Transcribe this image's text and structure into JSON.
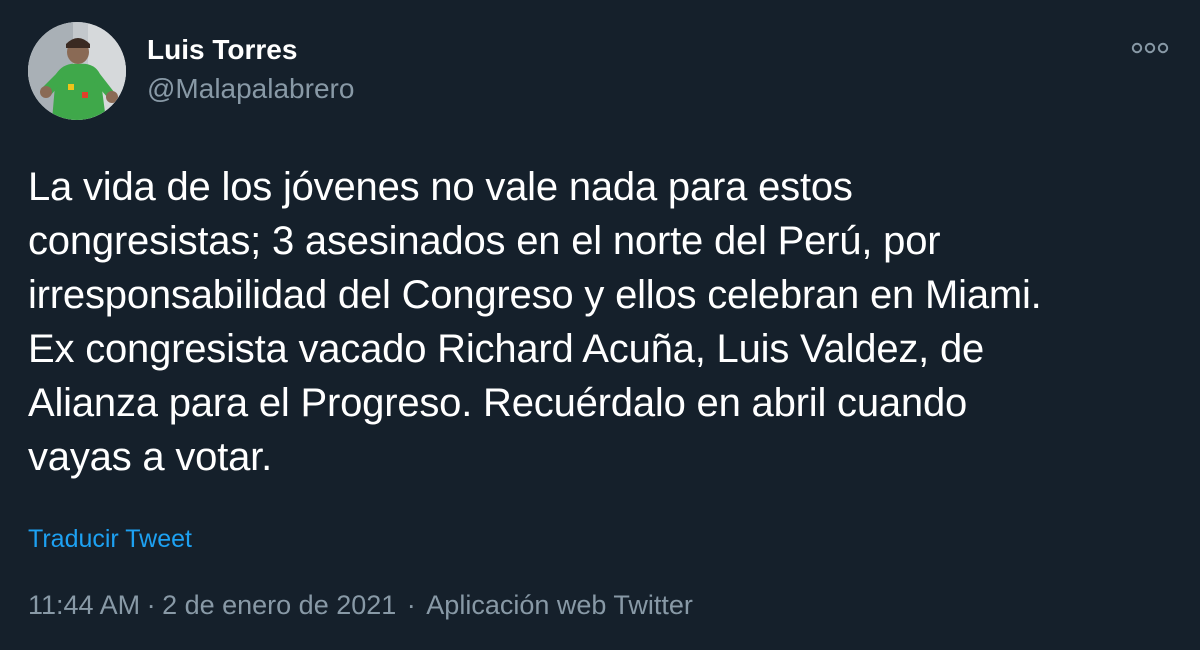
{
  "author": {
    "display_name": "Luis Torres",
    "handle": "@Malapalabrero",
    "avatar_icon": "profile-photo"
  },
  "tweet": {
    "text": "La vida de los jóvenes no vale nada para estos\ncongresistas; 3 asesinados en el norte del Perú, por\nirresponsabilidad del Congreso y ellos celebran en Miami.\nEx congresista vacado Richard Acuña, Luis Valdez, de\nAlianza para el Progreso. Recuérdalo en abril cuando\nvayas a votar.",
    "translate_label": "Traducir Tweet"
  },
  "meta": {
    "time": "11:44 AM",
    "date": "2 de enero de 2021",
    "separator": "·",
    "source": "Aplicación web Twitter"
  },
  "icons": {
    "more": "more-options-icon"
  },
  "colors": {
    "background": "#15202b",
    "primary_text": "#ffffff",
    "secondary_text": "#8899a6",
    "link": "#1da1f2"
  }
}
